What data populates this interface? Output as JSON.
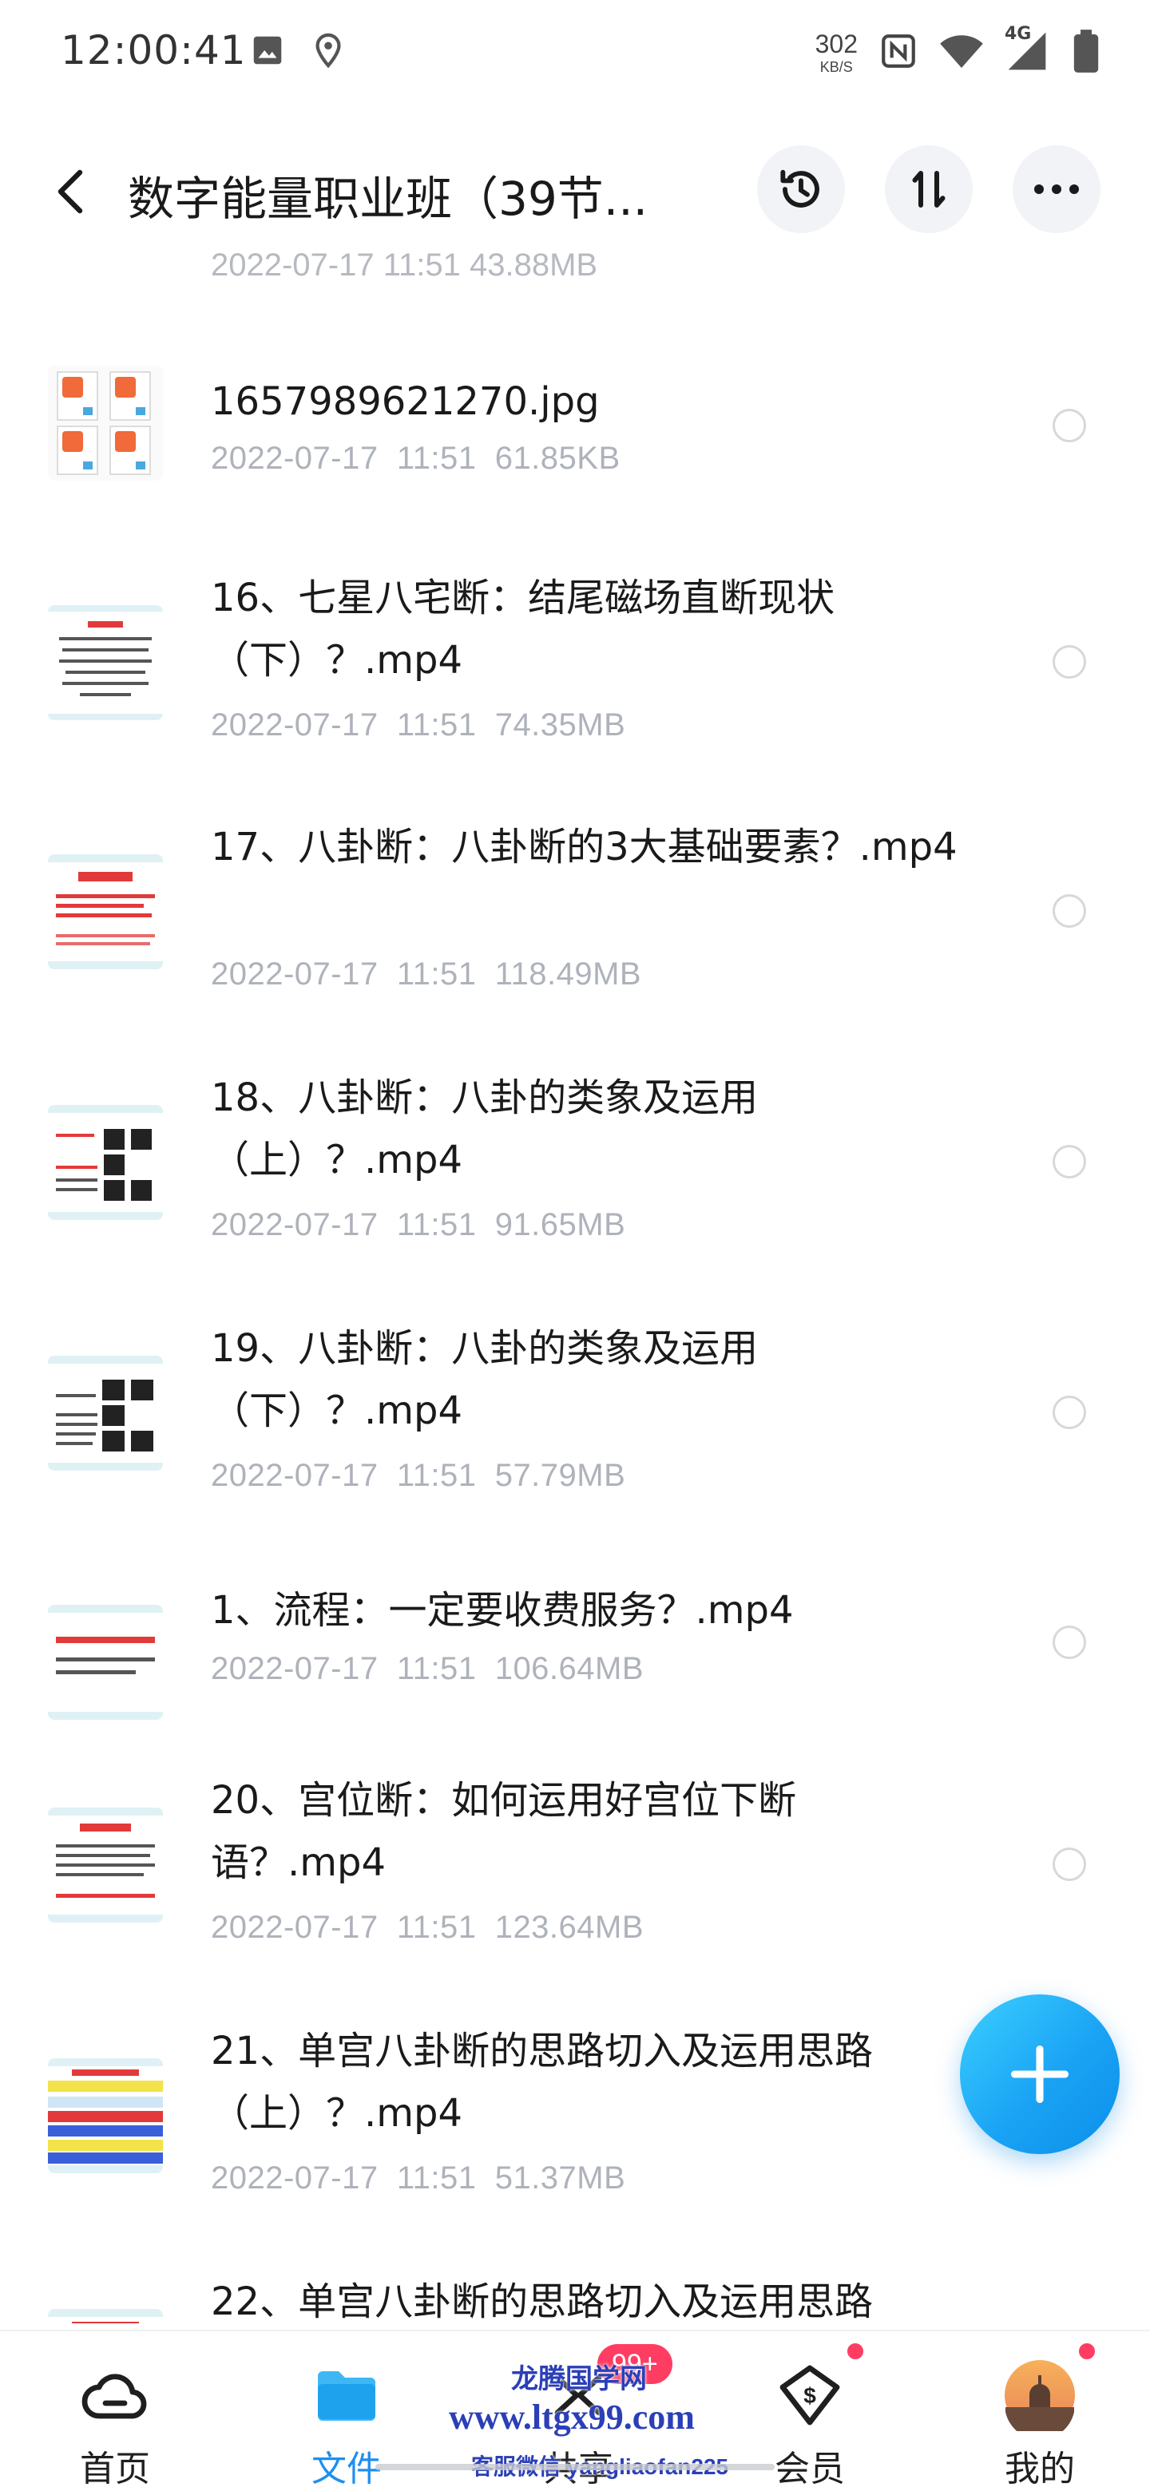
{
  "status_bar": {
    "time": "12:00:41",
    "net_speed_value": "302",
    "net_speed_unit": "KB/S",
    "network": "4G",
    "left_icons": [
      "image-icon",
      "location-icon"
    ],
    "right_icons": [
      "nfc-icon",
      "wifi-icon",
      "signal-icon",
      "battery-icon"
    ]
  },
  "header": {
    "title": "数字能量职业班（39节...",
    "buttons": [
      "back-icon",
      "history-icon",
      "sort-icon",
      "more-icon"
    ]
  },
  "file_list": {
    "partial_top_meta": "2022-07-17  11:51  43.88MB",
    "items": [
      {
        "name": "1657989621270.jpg",
        "date": "2022-07-17",
        "time": "11:51",
        "size": "61.85KB",
        "meta": "2022-07-17  11:51  61.85KB"
      },
      {
        "name": "16、七星八宅断：结尾磁场直断现状（下）？.mp4",
        "date": "2022-07-17",
        "time": "11:51",
        "size": "74.35MB",
        "meta": "2022-07-17  11:51  74.35MB"
      },
      {
        "name": "17、八卦断：八卦断的3大基础要素？.mp4",
        "date": "2022-07-17",
        "time": "11:51",
        "size": "118.49MB",
        "meta": "2022-07-17  11:51  118.49MB"
      },
      {
        "name": "18、八卦断：八卦的类象及运用（上）？.mp4",
        "date": "2022-07-17",
        "time": "11:51",
        "size": "91.65MB",
        "meta": "2022-07-17  11:51  91.65MB"
      },
      {
        "name": "19、八卦断：八卦的类象及运用（下）？.mp4",
        "date": "2022-07-17",
        "time": "11:51",
        "size": "57.79MB",
        "meta": "2022-07-17  11:51  57.79MB"
      },
      {
        "name": "1、流程：一定要收费服务？.mp4",
        "date": "2022-07-17",
        "time": "11:51",
        "size": "106.64MB",
        "meta": "2022-07-17  11:51  106.64MB"
      },
      {
        "name": "20、宫位断：如何运用好宫位下断语？.mp4",
        "date": "2022-07-17",
        "time": "11:51",
        "size": "123.64MB",
        "meta": "2022-07-17  11:51  123.64MB"
      },
      {
        "name": "21、单宫八卦断的思路切入及运用思路（上）？.mp4",
        "date": "2022-07-17",
        "time": "11:51",
        "size": "51.37MB",
        "meta": "2022-07-17  11:51  51.37MB"
      },
      {
        "name": "22、单宫八卦断的思路切入及运用思路",
        "date": "",
        "time": "",
        "size": "",
        "meta": ""
      }
    ]
  },
  "fab": {
    "icon": "plus-icon"
  },
  "bottom_nav": {
    "items": [
      {
        "label": "首页",
        "icon": "cloud-icon",
        "active": false
      },
      {
        "label": "文件",
        "icon": "folder-icon",
        "active": true
      },
      {
        "label": "共享",
        "icon": "share-icon",
        "active": false
      },
      {
        "label": "会员",
        "icon": "vip-icon",
        "active": false
      },
      {
        "label": "我的",
        "icon": "avatar-icon",
        "active": false
      }
    ],
    "share_badge": "99+"
  },
  "watermark": {
    "line1": "龙腾国学网",
    "line2": "www.ltgx99.com",
    "line3": "客服微信 yangliaofan225"
  },
  "colors": {
    "accent": "#1f8ef1",
    "badge": "#ff3d63",
    "meta_text": "#aeb2ba"
  }
}
